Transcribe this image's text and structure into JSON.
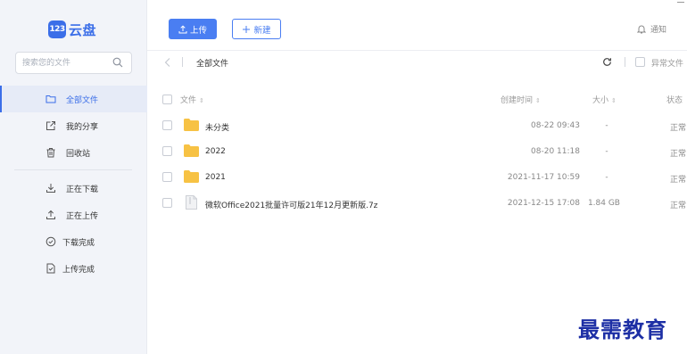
{
  "app": {
    "logo_badge": "123",
    "logo_text": "云盘"
  },
  "search": {
    "placeholder": "搜索您的文件"
  },
  "sidebar": {
    "items": [
      {
        "label": "全部文件",
        "icon": "folder-icon",
        "active": true
      },
      {
        "label": "我的分享",
        "icon": "share-icon"
      },
      {
        "label": "回收站",
        "icon": "trash-icon"
      },
      {
        "label": "正在下载",
        "icon": "download-icon"
      },
      {
        "label": "正在上传",
        "icon": "upload-icon"
      },
      {
        "label": "下载完成",
        "icon": "check-circle-icon"
      },
      {
        "label": "上传完成",
        "icon": "file-check-icon"
      }
    ]
  },
  "toolbar": {
    "upload_label": "上传",
    "new_label": "新建",
    "notify_label": "通知"
  },
  "breadcrumb": {
    "current": "全部文件"
  },
  "filter": {
    "abnormal_label": "异常文件"
  },
  "table": {
    "headers": {
      "name": "文件",
      "time": "创建时间",
      "size": "大小",
      "status": "状态"
    },
    "rows": [
      {
        "name": "未分类",
        "type": "folder",
        "time": "08-22 09:43",
        "size": "-",
        "status": "正常"
      },
      {
        "name": "2022",
        "type": "folder",
        "time": "08-20 11:18",
        "size": "-",
        "status": "正常"
      },
      {
        "name": "2021",
        "type": "folder",
        "time": "2021-11-17 10:59",
        "size": "-",
        "status": "正常"
      },
      {
        "name": "微软Office2021批量许可版21年12月更新版.7z",
        "type": "file",
        "time": "2021-12-15 17:08",
        "size": "1.84 GB",
        "status": "正常"
      }
    ]
  },
  "watermark": "最需教育",
  "colors": {
    "accent": "#4a7ef2",
    "folder": "#f7c244",
    "sidebar_bg": "#f2f4f9",
    "watermark": "#1d2fa5"
  }
}
